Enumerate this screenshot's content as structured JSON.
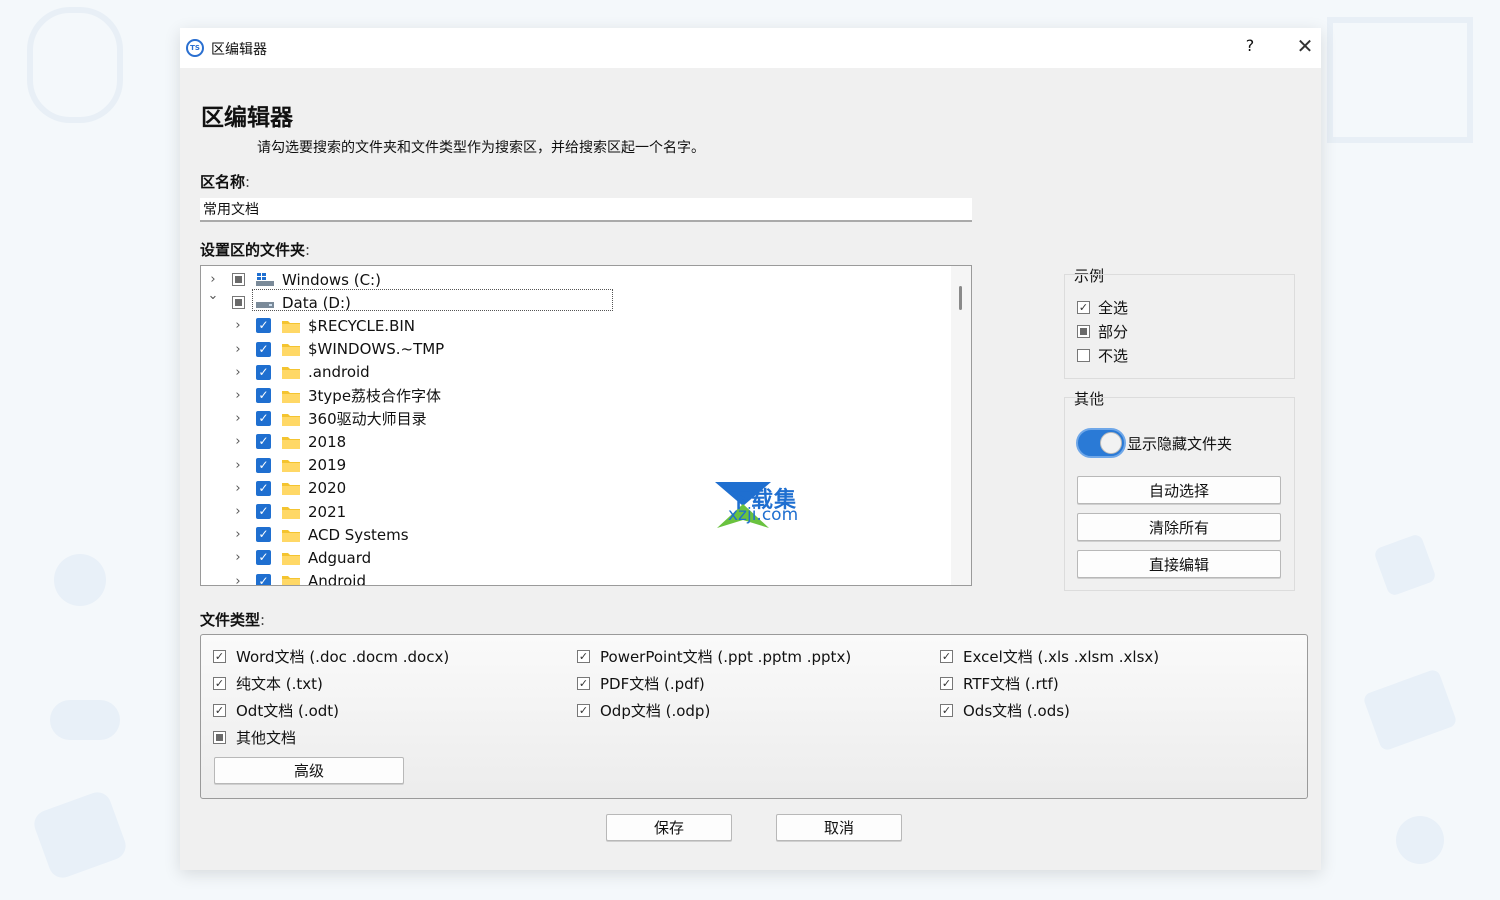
{
  "window": {
    "title": "区编辑器",
    "help_label": "?",
    "close_label": "✕"
  },
  "header": {
    "heading": "区编辑器",
    "description": "请勾选要搜索的文件夹和文件类型作为搜索区，并给搜索区起一个名字。"
  },
  "zone_name": {
    "label": "区名称",
    "colon": ":",
    "value": "常用文档"
  },
  "folders": {
    "label": "设置区的文件夹",
    "colon": ":",
    "items": [
      {
        "label": "Windows (C:)",
        "level": 0,
        "expanded": false,
        "check": "partial",
        "icon": "drive-windows-icon"
      },
      {
        "label": "Data (D:)",
        "level": 0,
        "expanded": true,
        "check": "partial",
        "icon": "drive-icon"
      },
      {
        "label": "$RECYCLE.BIN",
        "level": 1,
        "check": "checked",
        "icon": "folder-icon"
      },
      {
        "label": "$WINDOWS.~TMP",
        "level": 1,
        "check": "checked",
        "icon": "folder-icon"
      },
      {
        "label": ".android",
        "level": 1,
        "check": "checked",
        "icon": "folder-icon"
      },
      {
        "label": "3type荔枝合作字体",
        "level": 1,
        "check": "checked",
        "icon": "folder-icon"
      },
      {
        "label": "360驱动大师目录",
        "level": 1,
        "check": "checked",
        "icon": "folder-icon"
      },
      {
        "label": "2018",
        "level": 1,
        "check": "checked",
        "icon": "folder-icon"
      },
      {
        "label": "2019",
        "level": 1,
        "check": "checked",
        "icon": "folder-icon"
      },
      {
        "label": "2020",
        "level": 1,
        "check": "checked",
        "icon": "folder-icon"
      },
      {
        "label": "2021",
        "level": 1,
        "check": "checked",
        "icon": "folder-icon"
      },
      {
        "label": "ACD Systems",
        "level": 1,
        "check": "checked",
        "icon": "folder-icon"
      },
      {
        "label": "Adguard",
        "level": 1,
        "check": "checked",
        "icon": "folder-icon"
      },
      {
        "label": "Android",
        "level": 1,
        "check": "checked",
        "icon": "folder-icon"
      }
    ]
  },
  "legend": {
    "title": "示例",
    "items": [
      {
        "label": "全选",
        "state": "checked"
      },
      {
        "label": "部分",
        "state": "partial"
      },
      {
        "label": "不选",
        "state": "unchecked"
      }
    ]
  },
  "other": {
    "title": "其他",
    "toggle_label": "显示隐藏文件夹",
    "toggle_on": true,
    "auto_select_label": "自动选择",
    "clear_all_label": "清除所有",
    "direct_edit_label": "直接编辑"
  },
  "file_types": {
    "label": "文件类型",
    "colon": ":",
    "items": [
      {
        "label": "Word文档 (.doc .docm .docx)",
        "state": "checked"
      },
      {
        "label": "PowerPoint文档 (.ppt .pptm .pptx)",
        "state": "checked"
      },
      {
        "label": "Excel文档 (.xls .xlsm .xlsx)",
        "state": "checked"
      },
      {
        "label": "纯文本 (.txt)",
        "state": "checked"
      },
      {
        "label": "PDF文档 (.pdf)",
        "state": "checked"
      },
      {
        "label": "RTF文档 (.rtf)",
        "state": "checked"
      },
      {
        "label": "Odt文档 (.odt)",
        "state": "checked"
      },
      {
        "label": "Odp文档 (.odp)",
        "state": "checked"
      },
      {
        "label": "Ods文档 (.ods)",
        "state": "checked"
      },
      {
        "label": "其他文档",
        "state": "partial"
      }
    ],
    "advanced_label": "高级"
  },
  "footer": {
    "save_label": "保存",
    "cancel_label": "取消"
  },
  "watermark": {
    "brand": "下载集",
    "domain": "xzji.com"
  },
  "colors": {
    "accent": "#1f6fd0",
    "dialog_bg": "#f0f0f0",
    "toggle_on": "#2a7ad6"
  }
}
